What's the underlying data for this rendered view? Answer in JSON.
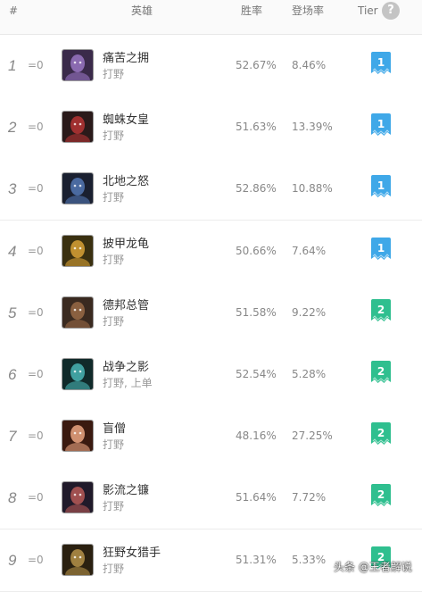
{
  "header": {
    "rank": "#",
    "hero": "英雄",
    "win_rate": "胜率",
    "pick_rate": "登场率",
    "tier": "Tier",
    "help": "?"
  },
  "rows": [
    {
      "rank": "1",
      "change": "=0",
      "name": "痛苦之拥",
      "role": "打野",
      "win": "52.67%",
      "pick": "8.46%",
      "tier": "1",
      "tier_color": "#3fa8e8",
      "avatar_bg": "#3a2a4a",
      "avatar_fg": "#8a6ab0"
    },
    {
      "rank": "2",
      "change": "=0",
      "name": "蜘蛛女皇",
      "role": "打野",
      "win": "51.63%",
      "pick": "13.39%",
      "tier": "1",
      "tier_color": "#3fa8e8",
      "avatar_bg": "#2a1a1a",
      "avatar_fg": "#a03030"
    },
    {
      "rank": "3",
      "change": "=0",
      "name": "北地之怒",
      "role": "打野",
      "win": "52.86%",
      "pick": "10.88%",
      "tier": "1",
      "tier_color": "#3fa8e8",
      "avatar_bg": "#1a2030",
      "avatar_fg": "#4a6aa0"
    },
    {
      "rank": "4",
      "change": "=0",
      "name": "披甲龙龟",
      "role": "打野",
      "win": "50.66%",
      "pick": "7.64%",
      "tier": "1",
      "tier_color": "#3fa8e8",
      "avatar_bg": "#3a3010",
      "avatar_fg": "#c09030"
    },
    {
      "rank": "5",
      "change": "=0",
      "name": "德邦总管",
      "role": "打野",
      "win": "51.58%",
      "pick": "9.22%",
      "tier": "2",
      "tier_color": "#2fbf8f",
      "avatar_bg": "#3a2a20",
      "avatar_fg": "#8a6040"
    },
    {
      "rank": "6",
      "change": "=0",
      "name": "战争之影",
      "role": "打野, 上单",
      "win": "52.54%",
      "pick": "5.28%",
      "tier": "2",
      "tier_color": "#2fbf8f",
      "avatar_bg": "#102a2a",
      "avatar_fg": "#40a0a0"
    },
    {
      "rank": "7",
      "change": "=0",
      "name": "盲僧",
      "role": "打野",
      "win": "48.16%",
      "pick": "27.25%",
      "tier": "2",
      "tier_color": "#2fbf8f",
      "avatar_bg": "#3a1a10",
      "avatar_fg": "#d09070"
    },
    {
      "rank": "8",
      "change": "=0",
      "name": "影流之镰",
      "role": "打野",
      "win": "51.64%",
      "pick": "7.72%",
      "tier": "2",
      "tier_color": "#2fbf8f",
      "avatar_bg": "#201a2a",
      "avatar_fg": "#a05050"
    },
    {
      "rank": "9",
      "change": "=0",
      "name": "狂野女猎手",
      "role": "打野",
      "win": "51.31%",
      "pick": "5.33%",
      "tier": "2",
      "tier_color": "#2fbf8f",
      "avatar_bg": "#2a2010",
      "avatar_fg": "#a08040"
    }
  ],
  "watermark": "头条 @王者解说"
}
